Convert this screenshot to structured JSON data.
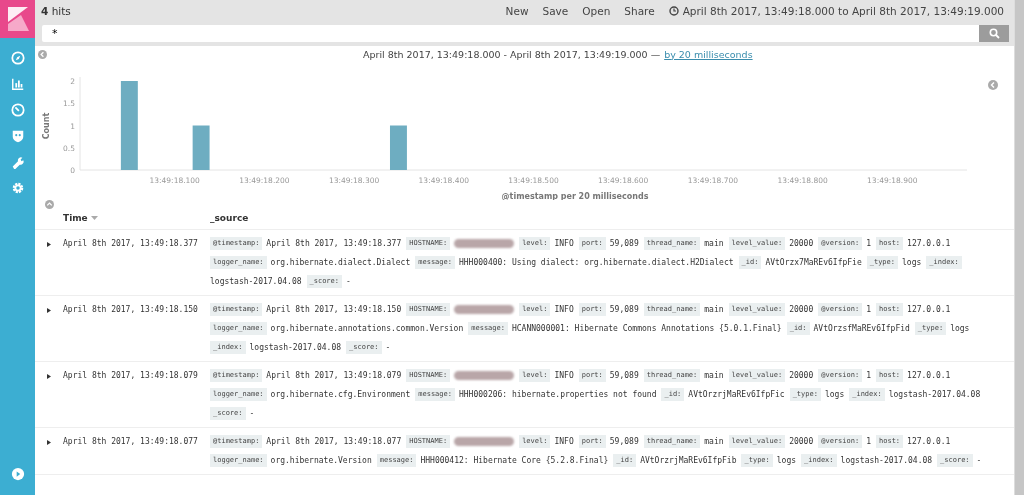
{
  "top_bar": {
    "hits": "**4** hits",
    "actions": [
      "New",
      "Save",
      "Open",
      "Share"
    ],
    "time_range": "April 8th 2017, 13:49:18.000 to April 8th 2017, 13:49:19.000"
  },
  "search": {
    "value": "*"
  },
  "histogram": {
    "range": "April 8th 2017, 13:49:18.000 - April 8th 2017, 13:49:19.000 —",
    "interval_link": "by 20 milliseconds",
    "chart_data": {
      "type": "bar",
      "xlabel": "@timestamp per 20 milliseconds",
      "ylabel": "Count",
      "ylim": [
        0,
        2
      ],
      "yticks": [
        0,
        0.5,
        1,
        1.5,
        2
      ],
      "categories": [
        null,
        null,
        null,
        null,
        null,
        "13:49:18.100",
        null,
        null,
        null,
        null,
        "13:49:18.200",
        null,
        null,
        null,
        null,
        "13:49:18.300",
        null,
        null,
        null,
        null,
        "13:49:18.400",
        null,
        null,
        null,
        null,
        "13:49:18.500",
        null,
        null,
        null,
        null,
        "13:49:18.600",
        null,
        null,
        null,
        null,
        "13:49:18.700",
        null,
        null,
        null,
        null,
        "13:49:18.800",
        null,
        null,
        null,
        null,
        "13:49:18.900",
        null,
        null,
        null,
        null
      ],
      "values": [
        0,
        0,
        2,
        0,
        0,
        0,
        1,
        0,
        0,
        0,
        0,
        0,
        0,
        0,
        0,
        0,
        0,
        1,
        0,
        0,
        0,
        0,
        0,
        0,
        0,
        0,
        0,
        0,
        0,
        0,
        0,
        0,
        0,
        0,
        0,
        0,
        0,
        0,
        0,
        0,
        0,
        0,
        0,
        0,
        0,
        0,
        0,
        0,
        0,
        0
      ]
    }
  },
  "table": {
    "columns": [
      {
        "label": "Time",
        "sortable": true
      },
      {
        "label": "_source",
        "sortable": false
      }
    ],
    "rows": [
      {
        "time": "April 8th 2017, 13:49:18.377",
        "fields": [
          {
            "key": "@timestamp:",
            "value": "April 8th 2017, 13:49:18.377"
          },
          {
            "key": "HOSTNAME:",
            "redacted": true
          },
          {
            "key": "level:",
            "value": "INFO"
          },
          {
            "key": "port:",
            "value": "59,089"
          },
          {
            "key": "thread_name:",
            "value": "main"
          },
          {
            "key": "level_value:",
            "value": "20000"
          },
          {
            "key": "@version:",
            "value": "1"
          },
          {
            "key": "host:",
            "value": "127.0.0.1"
          },
          {
            "key": "logger_name:",
            "value": "org.hibernate.dialect.Dialect"
          },
          {
            "key": "message:",
            "value": "HHH000400: Using dialect: org.hibernate.dialect.H2Dialect"
          },
          {
            "key": "_id:",
            "value": "AVtOrzx7MaREv6IfpFie"
          },
          {
            "key": "_type:",
            "value": "logs"
          },
          {
            "key": "_index:",
            "value": "logstash-2017.04.08"
          },
          {
            "key": "_score:",
            "value": "-"
          }
        ]
      },
      {
        "time": "April 8th 2017, 13:49:18.150",
        "fields": [
          {
            "key": "@timestamp:",
            "value": "April 8th 2017, 13:49:18.150"
          },
          {
            "key": "HOSTNAME:",
            "redacted": true
          },
          {
            "key": "level:",
            "value": "INFO"
          },
          {
            "key": "port:",
            "value": "59,089"
          },
          {
            "key": "thread_name:",
            "value": "main"
          },
          {
            "key": "level_value:",
            "value": "20000"
          },
          {
            "key": "@version:",
            "value": "1"
          },
          {
            "key": "host:",
            "value": "127.0.0.1"
          },
          {
            "key": "logger_name:",
            "value": "org.hibernate.annotations.common.Version"
          },
          {
            "key": "message:",
            "value": "HCANN000001: Hibernate Commons Annotations {5.0.1.Final}"
          },
          {
            "key": "_id:",
            "value": "AVtOrzsfMaREv6IfpFid"
          },
          {
            "key": "_type:",
            "value": "logs"
          },
          {
            "key": "_index:",
            "value": "logstash-2017.04.08"
          },
          {
            "key": "_score:",
            "value": "-"
          }
        ]
      },
      {
        "time": "April 8th 2017, 13:49:18.079",
        "fields": [
          {
            "key": "@timestamp:",
            "value": "April 8th 2017, 13:49:18.079"
          },
          {
            "key": "HOSTNAME:",
            "redacted": true
          },
          {
            "key": "level:",
            "value": "INFO"
          },
          {
            "key": "port:",
            "value": "59,089"
          },
          {
            "key": "thread_name:",
            "value": "main"
          },
          {
            "key": "level_value:",
            "value": "20000"
          },
          {
            "key": "@version:",
            "value": "1"
          },
          {
            "key": "host:",
            "value": "127.0.0.1"
          },
          {
            "key": "logger_name:",
            "value": "org.hibernate.cfg.Environment"
          },
          {
            "key": "message:",
            "value": "HHH000206: hibernate.properties not found"
          },
          {
            "key": "_id:",
            "value": "AVtOrzrjMaREv6IfpFic"
          },
          {
            "key": "_type:",
            "value": "logs"
          },
          {
            "key": "_index:",
            "value": "logstash-2017.04.08"
          },
          {
            "key": "_score:",
            "value": "-"
          }
        ]
      },
      {
        "time": "April 8th 2017, 13:49:18.077",
        "fields": [
          {
            "key": "@timestamp:",
            "value": "April 8th 2017, 13:49:18.077"
          },
          {
            "key": "HOSTNAME:",
            "redacted": true
          },
          {
            "key": "level:",
            "value": "INFO"
          },
          {
            "key": "port:",
            "value": "59,089"
          },
          {
            "key": "thread_name:",
            "value": "main"
          },
          {
            "key": "level_value:",
            "value": "20000"
          },
          {
            "key": "@version:",
            "value": "1"
          },
          {
            "key": "host:",
            "value": "127.0.0.1"
          },
          {
            "key": "logger_name:",
            "value": "org.hibernate.Version"
          },
          {
            "key": "message:",
            "value": "HHH000412: Hibernate Core {5.2.8.Final}"
          },
          {
            "key": "_id:",
            "value": "AVtOrzrjMaREv6IfpFib"
          },
          {
            "key": "_type:",
            "value": "logs"
          },
          {
            "key": "_index:",
            "value": "logstash-2017.04.08"
          },
          {
            "key": "_score:",
            "value": "-"
          }
        ]
      }
    ]
  }
}
